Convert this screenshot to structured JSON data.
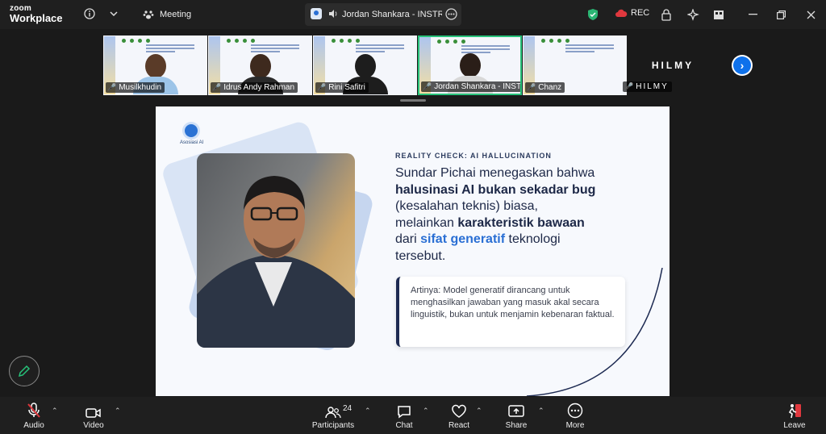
{
  "app": {
    "brand_line1": "zoom",
    "brand_line2": "Workplace",
    "tab_label": "Meeting",
    "presenter_label": "Jordan Shankara - INSTRUKT",
    "rec_label": "REC"
  },
  "participants": [
    {
      "name": "Musilkhudin",
      "muted": true
    },
    {
      "name": "Idrus Andy Rahman",
      "muted": true
    },
    {
      "name": "Rini Safitri",
      "muted": true
    },
    {
      "name": "Jordan Shankara - INSTR...",
      "muted": true,
      "active": true
    },
    {
      "name": "Chanz",
      "muted": true
    }
  ],
  "hilmy": {
    "big_label": "HILMY",
    "tag": "HILMY"
  },
  "slide": {
    "logo_text": "Asosiasi AI",
    "eyebrow": "REALITY CHECK: AI HALLUCINATION",
    "line1": "Sundar Pichai menegaskan bahwa",
    "line2_bold": "halusinasi AI bukan sekadar bug",
    "line3": "(kesalahan teknis) biasa,",
    "line4a": "melainkan ",
    "line4_bold": "karakteristik bawaan",
    "line5a": "dari ",
    "line5_blue": "sifat generatif",
    "line5b": " teknologi",
    "line6": "tersebut.",
    "callout": "Artinya: Model generatif dirancang untuk menghasilkan jawaban yang masuk akal secara linguistik, bukan untuk menjamin kebenaran faktual."
  },
  "toolbar": {
    "audio": "Audio",
    "video": "Video",
    "participants": "Participants",
    "participants_count": "24",
    "chat": "Chat",
    "react": "React",
    "share": "Share",
    "more": "More",
    "leave": "Leave"
  },
  "colors": {
    "accent": "#0e71eb",
    "active_border": "#27c27a",
    "mute_red": "#e0383e",
    "slide_blue": "#2a6fd4"
  }
}
